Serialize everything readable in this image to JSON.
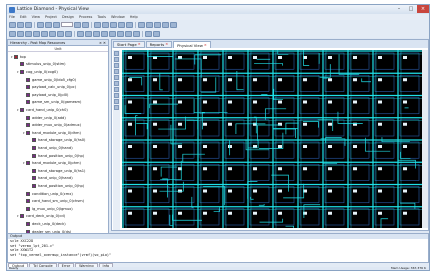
{
  "window": {
    "title": "Lattice Diamond - Physical View"
  },
  "menu": [
    "File",
    "Edit",
    "View",
    "Project",
    "Design",
    "Process",
    "Tools",
    "Window",
    "Help"
  ],
  "left_panel": {
    "title": "Hierarchy - Post Map Resources",
    "column_header": "Unit",
    "tree": [
      {
        "label": "top",
        "level": 0,
        "toggle": "▾",
        "color": "#a23"
      },
      {
        "label": "stimulus_unip_0(stim)",
        "level": 1,
        "toggle": "",
        "color": "#7a2a88"
      },
      {
        "label": "cog_unip_0(cog0)",
        "level": 1,
        "toggle": "▾",
        "color": "#7a2a88"
      },
      {
        "label": "game_unip_0(ldo5_cfg0)",
        "level": 2,
        "toggle": "",
        "color": "#7a2a88"
      },
      {
        "label": "payload_calc_unip_0(pc)",
        "level": 2,
        "toggle": "",
        "color": "#7a2a88"
      },
      {
        "label": "payload_unip_0(pl0)",
        "level": 2,
        "toggle": "",
        "color": "#7a2a88"
      },
      {
        "label": "game_sm_unip_0(gamesm)",
        "level": 2,
        "toggle": "",
        "color": "#7a2a88"
      },
      {
        "label": "card_hand_unip_0(ch0)",
        "level": 1,
        "toggle": "▾",
        "color": "#7a2a88"
      },
      {
        "label": "adder_unip_0(add)",
        "level": 2,
        "toggle": "",
        "color": "#7a2a88"
      },
      {
        "label": "adder_mux_unip_0(admux)",
        "level": 2,
        "toggle": "",
        "color": "#7a2a88"
      },
      {
        "label": "hand_module_unip_0(dhm)",
        "level": 2,
        "toggle": "▾",
        "color": "#7a2a88"
      },
      {
        "label": "hand_storage_unip_0(hs0)",
        "level": 3,
        "toggle": "",
        "color": "#7a2a88"
      },
      {
        "label": "hand_unip_0(hand)",
        "level": 3,
        "toggle": "",
        "color": "#7a2a88"
      },
      {
        "label": "hand_position_unip_0(hp)",
        "level": 3,
        "toggle": "",
        "color": "#7a2a88"
      },
      {
        "label": "hand_module_unip_0(phm)",
        "level": 2,
        "toggle": "▾",
        "color": "#7a2a88"
      },
      {
        "label": "hand_storage_unip_0(hs1)",
        "level": 3,
        "toggle": "",
        "color": "#7a2a88"
      },
      {
        "label": "hand_unip_0(hand)",
        "level": 3,
        "toggle": "",
        "color": "#7a2a88"
      },
      {
        "label": "hand_position_unip_0(hp)",
        "level": 3,
        "toggle": "",
        "color": "#7a2a88"
      },
      {
        "label": "condition_unip_0(cmx)",
        "level": 2,
        "toggle": "",
        "color": "#7a2a88"
      },
      {
        "label": "card_hand_sm_unip_0(chsm)",
        "level": 2,
        "toggle": "",
        "color": "#7a2a88"
      },
      {
        "label": "lg_mux_unip_0(lgmux)",
        "level": 2,
        "toggle": "",
        "color": "#7a2a88"
      },
      {
        "label": "card_deck_unip_0(cd)",
        "level": 1,
        "toggle": "▾",
        "color": "#7a2a88"
      },
      {
        "label": "deck_unip_0(deck)",
        "level": 2,
        "toggle": "",
        "color": "#7a2a88"
      },
      {
        "label": "dealer_sm_unip_0(ds)",
        "level": 2,
        "toggle": "",
        "color": "#7a2a88"
      }
    ],
    "bottom_tabs": [
      "File",
      "Process",
      "Hierarchy - Post Map Reso..."
    ]
  },
  "right_panel": {
    "tabs": [
      {
        "label": "Start Page",
        "active": false
      },
      {
        "label": "Reports",
        "active": false
      },
      {
        "label": "Physical View",
        "active": true
      }
    ]
  },
  "output": {
    "header": "Output",
    "lines": [
      "scle XXC22D",
      "set \"vermo_lpt_201.c\"",
      "sele XXW1T2",
      "set \"top_vermel_overmup_instance\"(vrmf)(vo_pio)\""
    ],
    "tabs": [
      "Output",
      "Tcl Console",
      "Error",
      "Warning",
      "Info"
    ]
  },
  "status": {
    "left": "Ready",
    "right": "Mem Usage: 367,376 K"
  },
  "colors": {
    "route": "#1fe0e8",
    "canvas_bg": "#000000",
    "grid": "#2a5caa",
    "block": "#e6f2f8"
  }
}
